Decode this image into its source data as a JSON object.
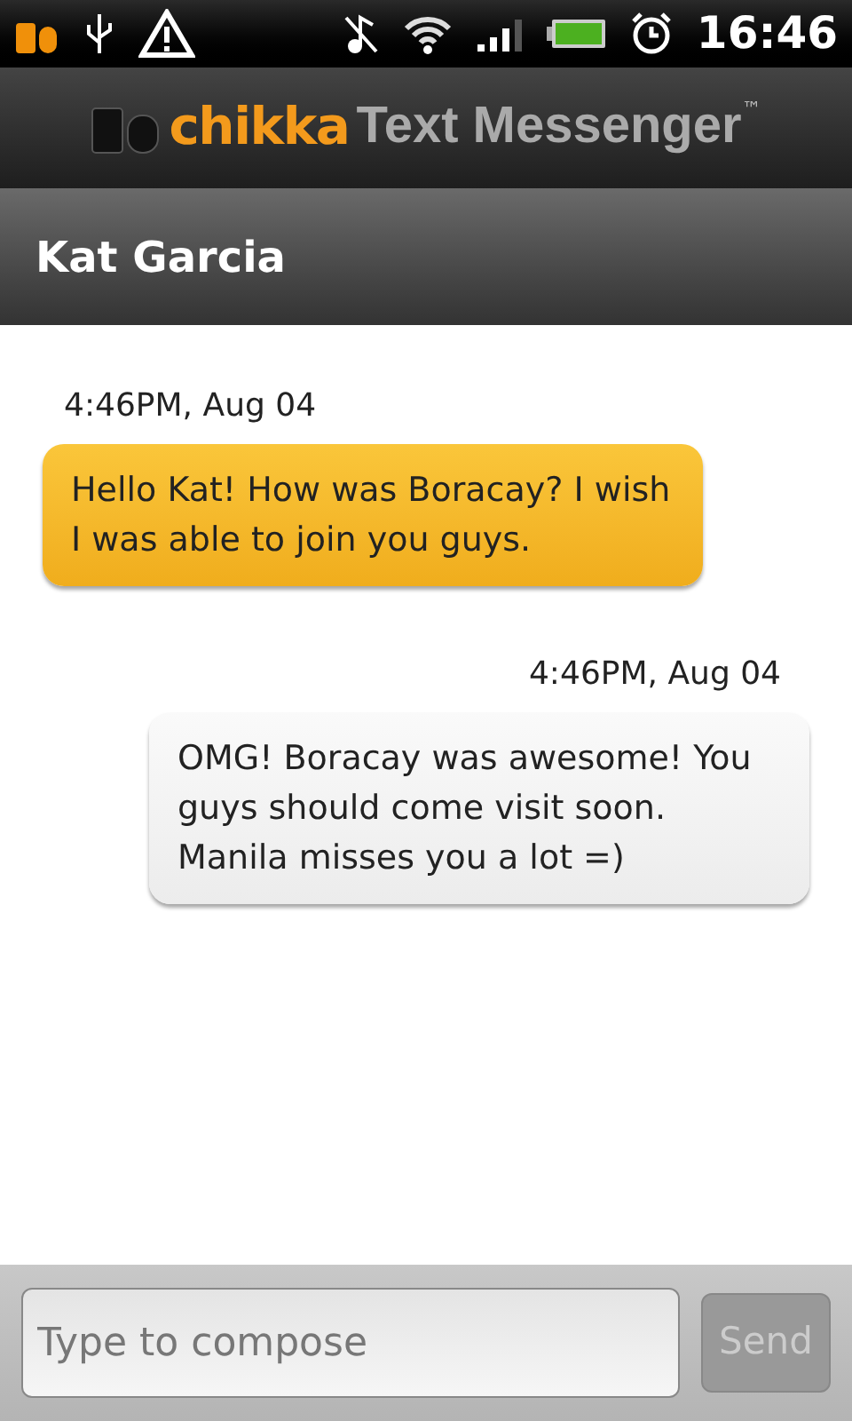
{
  "status_bar": {
    "time": "16:46"
  },
  "app_bar": {
    "brand": "chikka",
    "title": "Text Messenger",
    "trademark": "™"
  },
  "conversation": {
    "contact": "Kat Garcia"
  },
  "messages": [
    {
      "kind": "sent",
      "time": "4:46PM, Aug 04",
      "text": "Hello Kat! How was Boracay? I wish I was able to join you guys."
    },
    {
      "kind": "received",
      "time": "4:46PM, Aug 04",
      "text": "OMG! Boracay was awesome! You guys should come visit soon. Manila misses you a lot =)"
    }
  ],
  "composer": {
    "placeholder": "Type to compose",
    "send": {
      "label": "Send",
      "disabled": true
    }
  }
}
